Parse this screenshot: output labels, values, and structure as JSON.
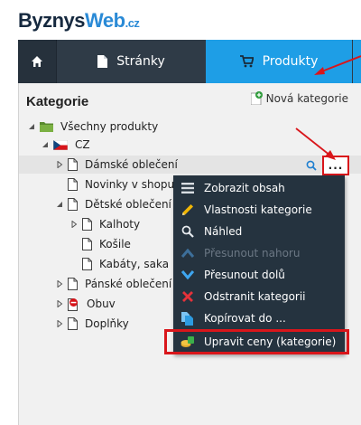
{
  "brand": {
    "part1": "Byznys",
    "part2": "Web",
    "suffix": ".cz"
  },
  "nav": {
    "home_icon": "home-icon",
    "tabs": [
      {
        "label": "Stránky",
        "icon": "page-icon"
      },
      {
        "label": "Produkty",
        "icon": "cart-icon",
        "active": true
      }
    ]
  },
  "panel": {
    "title": "Kategorie",
    "new_category": "Nová kategorie"
  },
  "tree": [
    {
      "label": "Všechny produkty",
      "level": 0,
      "icon": "folder-icon",
      "expanded": true
    },
    {
      "label": "CZ",
      "level": 1,
      "icon": "czech-flag-icon",
      "expanded": true
    },
    {
      "label": "Dámské oblečení",
      "level": 2,
      "icon": "page-icon",
      "collapsed": true,
      "highlighted": true
    },
    {
      "label": "Novinky v shopu",
      "level": 2,
      "icon": "page-icon"
    },
    {
      "label": "Dětské oblečení",
      "level": 2,
      "icon": "page-icon",
      "expanded": true
    },
    {
      "label": "Kalhoty",
      "level": 3,
      "icon": "page-icon",
      "collapsed": true
    },
    {
      "label": "Košile",
      "level": 3,
      "icon": "page-icon"
    },
    {
      "label": "Kabáty, saka",
      "level": 3,
      "icon": "page-icon"
    },
    {
      "label": "Pánské oblečení",
      "level": 2,
      "icon": "page-icon",
      "collapsed": true
    },
    {
      "label": "Obuv",
      "level": 2,
      "icon": "no-entry-icon",
      "collapsed": true
    },
    {
      "label": "Doplňky",
      "level": 2,
      "icon": "page-icon",
      "collapsed": true
    }
  ],
  "row_actions": {
    "search_icon": "search-icon",
    "more_label": "..."
  },
  "context_menu": [
    {
      "label": "Zobrazit obsah",
      "icon": "list-icon"
    },
    {
      "label": "Vlastnosti kategorie",
      "icon": "pencil-icon"
    },
    {
      "label": "Náhled",
      "icon": "search-icon"
    },
    {
      "label": "Přesunout nahoru",
      "icon": "chevron-up-icon",
      "disabled": true
    },
    {
      "label": "Přesunout dolů",
      "icon": "chevron-down-icon"
    },
    {
      "label": "Odstranit kategorii",
      "icon": "delete-icon"
    },
    {
      "label": "Kopírovat do ...",
      "icon": "copy-icon"
    },
    {
      "label": "Upravit ceny (kategorie)",
      "icon": "price-edit-icon",
      "selected": true
    }
  ],
  "colors": {
    "accent": "#1e9ee6",
    "nav_dark": "#2f3b47",
    "menu_bg": "#25333f",
    "highlight_red": "#d9161b"
  }
}
